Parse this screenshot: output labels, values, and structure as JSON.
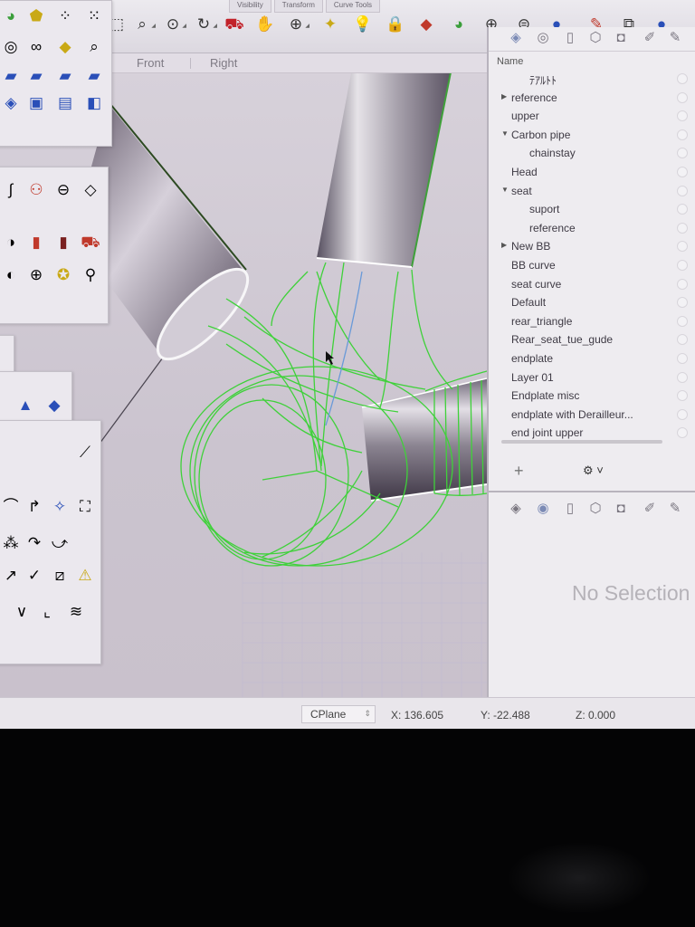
{
  "toolbar": {
    "tabs": [
      "Visibility",
      "Transform",
      "Curve Tools"
    ],
    "icons": [
      "select-window-icon",
      "zoom-extents-icon",
      "zoom-target-icon",
      "rotate-view-icon",
      "car-render-icon",
      "pan-icon",
      "snap-icon",
      "bulb-light-icon",
      "lock-icon",
      "material-icon",
      "color-wheel-icon",
      "sphere-wire-icon",
      "sphere-grid-icon",
      "sphere-render-icon"
    ]
  },
  "viewport": {
    "tabs": [
      "Front",
      "Right"
    ]
  },
  "layers": {
    "header": "Name",
    "rows": [
      {
        "name": "ﾃｱﾙﾄﾄ",
        "indent": 1,
        "expander": ""
      },
      {
        "name": "reference",
        "indent": 0,
        "expander": "▶"
      },
      {
        "name": "upper",
        "indent": 0,
        "expander": ""
      },
      {
        "name": "Carbon pipe",
        "indent": 0,
        "expander": "▼"
      },
      {
        "name": "chainstay",
        "indent": 1,
        "expander": ""
      },
      {
        "name": "Head",
        "indent": 0,
        "expander": ""
      },
      {
        "name": "seat",
        "indent": 0,
        "expander": "▼"
      },
      {
        "name": "suport",
        "indent": 1,
        "expander": ""
      },
      {
        "name": "reference",
        "indent": 1,
        "expander": ""
      },
      {
        "name": "New BB",
        "indent": 0,
        "expander": "▶"
      },
      {
        "name": "BB curve",
        "indent": 0,
        "expander": ""
      },
      {
        "name": "seat curve",
        "indent": 0,
        "expander": ""
      },
      {
        "name": "Default",
        "indent": 0,
        "expander": ""
      },
      {
        "name": "rear_triangle",
        "indent": 0,
        "expander": ""
      },
      {
        "name": "Rear_seat_tue_gude",
        "indent": 0,
        "expander": ""
      },
      {
        "name": "endplate",
        "indent": 0,
        "expander": ""
      },
      {
        "name": "Layer 01",
        "indent": 0,
        "expander": ""
      },
      {
        "name": "Endplate misc",
        "indent": 0,
        "expander": ""
      },
      {
        "name": "endplate with Derailleur...",
        "indent": 0,
        "expander": ""
      },
      {
        "name": "end joint upper",
        "indent": 0,
        "expander": ""
      }
    ],
    "add_label": "+",
    "gear_label": "⚙ ˅"
  },
  "properties": {
    "empty_text": "No Selection"
  },
  "status": {
    "cplane": "CPlane",
    "x": "X: 136.605",
    "y": "Y: -22.488",
    "z": "Z: 0.000"
  },
  "colors": {
    "wireframe": "#3fd13a",
    "accent": "#3b6fd8"
  }
}
